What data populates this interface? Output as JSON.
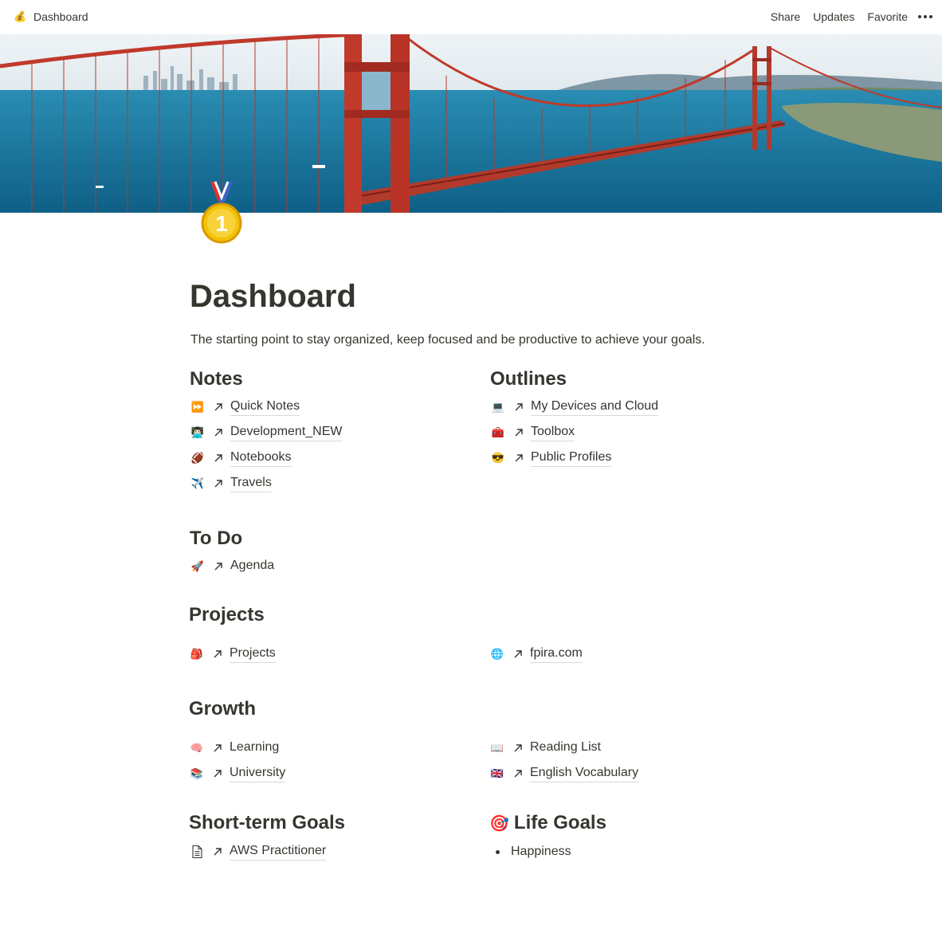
{
  "topbar": {
    "breadcrumb_icon": "💰",
    "breadcrumb_label": "Dashboard",
    "share_label": "Share",
    "updates_label": "Updates",
    "favorite_label": "Favorite"
  },
  "page": {
    "title": "Dashboard",
    "description": "The starting point to stay organized, keep focused and be productive to achieve your goals."
  },
  "notes": {
    "heading": "Notes",
    "items": [
      {
        "icon": "⏩",
        "label": "Quick Notes"
      },
      {
        "icon": "👨🏻‍💻",
        "label": "Development_NEW"
      },
      {
        "icon": "🏈",
        "label": "Notebooks"
      },
      {
        "icon": "✈️",
        "label": "Travels"
      }
    ]
  },
  "outlines": {
    "heading": "Outlines",
    "items": [
      {
        "icon": "💻",
        "label": "My Devices and Cloud"
      },
      {
        "icon": "🧰",
        "label": "Toolbox"
      },
      {
        "icon": "😎",
        "label": "Public Profiles"
      }
    ]
  },
  "todo": {
    "heading": "To Do",
    "items": [
      {
        "icon": "🚀",
        "label": "Agenda"
      }
    ]
  },
  "projects": {
    "heading": "Projects",
    "items": [
      {
        "icon": "🎒",
        "label": "Projects"
      },
      {
        "icon": "🌐",
        "label": "fpira.com"
      }
    ]
  },
  "growth": {
    "heading": "Growth",
    "items": [
      {
        "icon": "🧠",
        "label": "Learning"
      },
      {
        "icon": "📚",
        "label": "University"
      },
      {
        "icon": "📖",
        "label": "Reading List"
      },
      {
        "icon": "🇬🇧",
        "label": "English Vocabulary"
      }
    ]
  },
  "short_term": {
    "heading": "Short-term Goals",
    "items": [
      {
        "icon": "page-icon",
        "label": "AWS Practitioner"
      }
    ]
  },
  "life_goals": {
    "heading_icon": "🎯",
    "heading": "Life Goals",
    "bullets": [
      "Happiness"
    ]
  },
  "colors": {
    "text": "#37352f",
    "bridge": "#c0392b",
    "water": "#1f8fb8"
  }
}
